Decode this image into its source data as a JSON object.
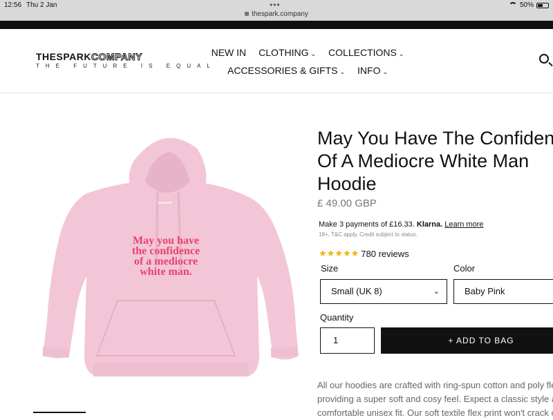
{
  "statusbar": {
    "time": "12:56",
    "date": "Thu 2 Jan",
    "url": "thespark.company",
    "battery": "50%",
    "battery_level": 0.5
  },
  "header": {
    "logo_main_bold": "THESPARK",
    "logo_main_outline": "COMPANY",
    "logo_tagline": "THE FUTURE IS EQUAL",
    "nav_row1": [
      {
        "label": "NEW IN",
        "has_dropdown": false
      },
      {
        "label": "CLOTHING",
        "has_dropdown": true
      },
      {
        "label": "COLLECTIONS",
        "has_dropdown": true
      }
    ],
    "nav_row2": [
      {
        "label": "ACCESSORIES & GIFTS",
        "has_dropdown": true
      },
      {
        "label": "INFO",
        "has_dropdown": true
      }
    ]
  },
  "product": {
    "title_line1": "May You Have The Confiden",
    "title_line2": "Of A Mediocre White Man",
    "title_line3": "Hoodie",
    "price": "£ 49.00 GBP",
    "klarna_prefix": "Make 3 payments of £16.33.",
    "klarna_brand": "Klarna.",
    "klarna_link": "Learn more",
    "klarna_note": "18+, T&C apply, Credit subject to status.",
    "rating_stars": 5,
    "reviews": "780 reviews",
    "size_label": "Size",
    "size_value": "Small (UK 8)",
    "color_label": "Color",
    "color_value": "Baby Pink",
    "quantity_label": "Quantity",
    "quantity_value": "1",
    "add_to_bag": "+ ADD TO BAG",
    "hoodie_print_line1": "May you have",
    "hoodie_print_line2": "the confidence",
    "hoodie_print_line3": "of a mediocre",
    "hoodie_print_line4": "white man.",
    "description_lines": [
      "All our hoodies are crafted with ring-spun cotton and poly fle",
      "providing a super soft and cosy feel. Expect a classic style a",
      "comfortable unisex fit. Our soft textile flex print won't crack o"
    ]
  },
  "colors": {
    "hoodie": "#f2c6d6",
    "hoodie_shade": "#e7b3c6",
    "print": "#e8416f",
    "button": "#111111",
    "star": "#f0b400"
  }
}
